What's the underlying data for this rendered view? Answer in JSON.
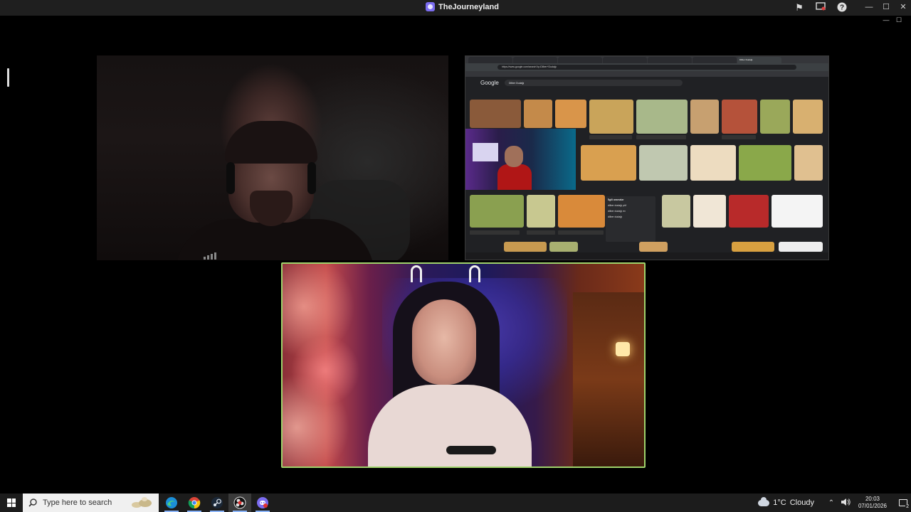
{
  "window": {
    "title": "TheJourneyland"
  },
  "share": {
    "url": "https://www.google.com/search?q=Dilber+Dudağı",
    "search_query": "Dilber Dudağı",
    "google_label": "Google",
    "related_header": "İlgili aramalar",
    "related_items": [
      "dilber dudağı püf",
      "dilber dudağı ev",
      "dilber dudağı"
    ]
  },
  "taskbar": {
    "search_placeholder": "Type here to search",
    "apps": [
      "edge-icon",
      "chrome-icon",
      "steam-icon",
      "obs-icon",
      "discord-icon"
    ],
    "weather": {
      "temp": "1°C",
      "condition": "Cloudy"
    },
    "time": "20:03",
    "date": "07/01/2026",
    "notification_count": "2"
  },
  "colors": {
    "guest_border": "#9fd36b",
    "taskbar_bg": "#1c1c1c",
    "titlebar_bg": "#1f1f1f"
  }
}
